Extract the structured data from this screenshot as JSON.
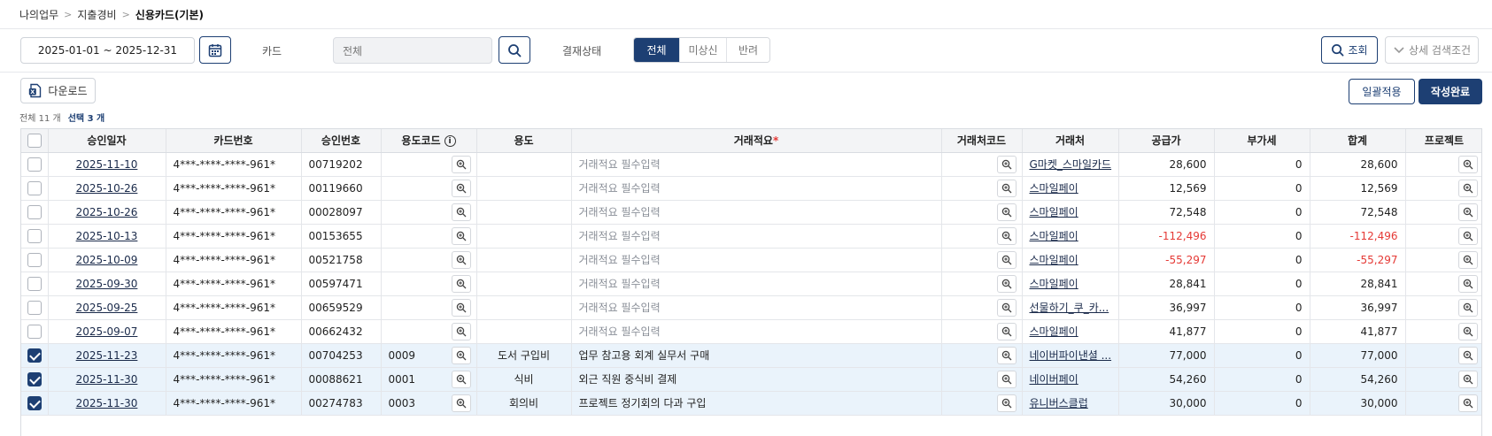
{
  "breadcrumb": {
    "level1": "나의업무",
    "level2": "지출경비",
    "current": "신용카드(기본)",
    "separator": ">"
  },
  "filters": {
    "date_range": "2025-01-01 ~ 2025-12-31",
    "card_label": "카드",
    "card_input_value": "전체",
    "status_label": "결재상태",
    "status_options": [
      "전체",
      "미상신",
      "반려"
    ],
    "status_selected": "전체",
    "query_label": "조회",
    "detail_label": "상세 검색조건"
  },
  "toolbar": {
    "download_label": "다운로드",
    "bulk_apply_label": "일괄적용",
    "complete_label": "작성완료",
    "total_text": "전체 11 개",
    "selected_text": "선택 3 개"
  },
  "table": {
    "headers": {
      "approval_date": "승인일자",
      "card_number": "카드번호",
      "approval_number": "승인번호",
      "usage_code": "용도코드",
      "usage": "용도",
      "description": "거래적요",
      "required_mark": "*",
      "vendor_code": "거래처코드",
      "vendor": "거래처",
      "supply": "공급가",
      "vat": "부가세",
      "total": "합계",
      "project": "프로젝트"
    },
    "description_placeholder": "거래적요 필수입력",
    "rows": [
      {
        "checked": false,
        "date": "2025-11-10",
        "card": "4***-****-****-961*",
        "approval": "00719202",
        "usage_code": "",
        "usage": "",
        "description": "",
        "vendor": "G마켓_스마일카드",
        "supply": "28,600",
        "vat": "0",
        "total": "28,600",
        "negative": false
      },
      {
        "checked": false,
        "date": "2025-10-26",
        "card": "4***-****-****-961*",
        "approval": "00119660",
        "usage_code": "",
        "usage": "",
        "description": "",
        "vendor": "스마일페이",
        "supply": "12,569",
        "vat": "0",
        "total": "12,569",
        "negative": false
      },
      {
        "checked": false,
        "date": "2025-10-26",
        "card": "4***-****-****-961*",
        "approval": "00028097",
        "usage_code": "",
        "usage": "",
        "description": "",
        "vendor": "스마일페이",
        "supply": "72,548",
        "vat": "0",
        "total": "72,548",
        "negative": false
      },
      {
        "checked": false,
        "date": "2025-10-13",
        "card": "4***-****-****-961*",
        "approval": "00153655",
        "usage_code": "",
        "usage": "",
        "description": "",
        "vendor": "스마일페이",
        "supply": "-112,496",
        "vat": "0",
        "total": "-112,496",
        "negative": true
      },
      {
        "checked": false,
        "date": "2025-10-09",
        "card": "4***-****-****-961*",
        "approval": "00521758",
        "usage_code": "",
        "usage": "",
        "description": "",
        "vendor": "스마일페이",
        "supply": "-55,297",
        "vat": "0",
        "total": "-55,297",
        "negative": true
      },
      {
        "checked": false,
        "date": "2025-09-30",
        "card": "4***-****-****-961*",
        "approval": "00597471",
        "usage_code": "",
        "usage": "",
        "description": "",
        "vendor": "스마일페이",
        "supply": "28,841",
        "vat": "0",
        "total": "28,841",
        "negative": false
      },
      {
        "checked": false,
        "date": "2025-09-25",
        "card": "4***-****-****-961*",
        "approval": "00659529",
        "usage_code": "",
        "usage": "",
        "description": "",
        "vendor": "선물하기_쿠_카...",
        "supply": "36,997",
        "vat": "0",
        "total": "36,997",
        "negative": false
      },
      {
        "checked": false,
        "date": "2025-09-07",
        "card": "4***-****-****-961*",
        "approval": "00662432",
        "usage_code": "",
        "usage": "",
        "description": "",
        "vendor": "스마일페이",
        "supply": "41,877",
        "vat": "0",
        "total": "41,877",
        "negative": false
      },
      {
        "checked": true,
        "date": "2025-11-23",
        "card": "4***-****-****-961*",
        "approval": "00704253",
        "usage_code": "0009",
        "usage": "도서 구입비",
        "description": "업무 참고용 회계 실무서 구매",
        "vendor": "네이버파이낸셜 ...",
        "supply": "77,000",
        "vat": "0",
        "total": "77,000",
        "negative": false
      },
      {
        "checked": true,
        "date": "2025-11-30",
        "card": "4***-****-****-961*",
        "approval": "00088621",
        "usage_code": "0001",
        "usage": "식비",
        "description": "외근 직원 중식비 결제",
        "vendor": "네이버페이",
        "supply": "54,260",
        "vat": "0",
        "total": "54,260",
        "negative": false
      },
      {
        "checked": true,
        "date": "2025-11-30",
        "card": "4***-****-****-961*",
        "approval": "00274783",
        "usage_code": "0003",
        "usage": "회의비",
        "description": "프로젝트 정기회의 다과 구입",
        "vendor": "유니버스클럽",
        "supply": "30,000",
        "vat": "0",
        "total": "30,000",
        "negative": false
      }
    ]
  }
}
